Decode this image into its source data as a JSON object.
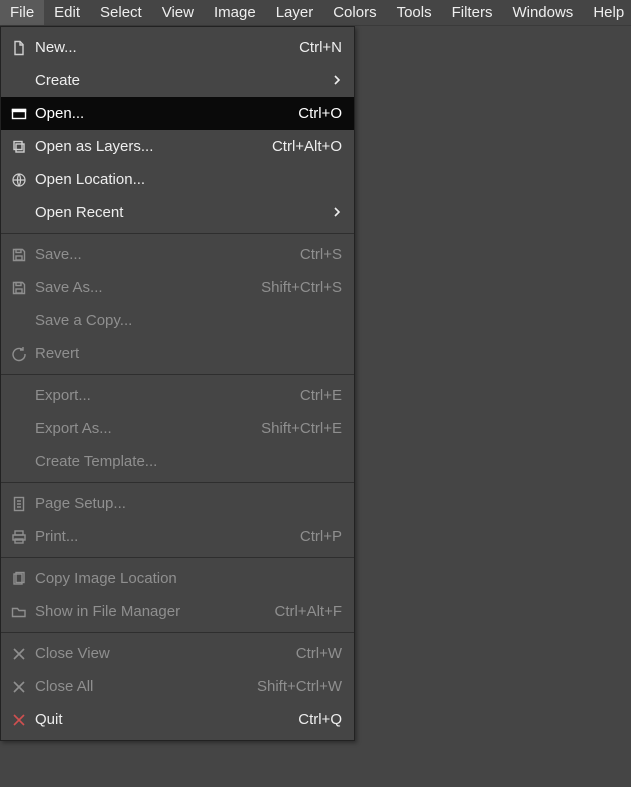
{
  "menubar": {
    "items": [
      "File",
      "Edit",
      "Select",
      "View",
      "Image",
      "Layer",
      "Colors",
      "Tools",
      "Filters",
      "Windows",
      "Help"
    ],
    "active_index": 0
  },
  "file_menu": {
    "highlighted_index": 2,
    "items": [
      {
        "icon": "new-icon",
        "label": "New...",
        "accel": "Ctrl+N",
        "enabled": true,
        "submenu": false
      },
      {
        "icon": "",
        "label": "Create",
        "accel": "",
        "enabled": true,
        "submenu": true
      },
      {
        "icon": "open-icon",
        "label": "Open...",
        "accel": "Ctrl+O",
        "enabled": true,
        "submenu": false
      },
      {
        "icon": "layers-icon",
        "label": "Open as Layers...",
        "accel": "Ctrl+Alt+O",
        "enabled": true,
        "submenu": false
      },
      {
        "icon": "globe-icon",
        "label": "Open Location...",
        "accel": "",
        "enabled": true,
        "submenu": false
      },
      {
        "icon": "",
        "label": "Open Recent",
        "accel": "",
        "enabled": true,
        "submenu": true
      },
      {
        "sep": true
      },
      {
        "icon": "save-icon",
        "label": "Save...",
        "accel": "Ctrl+S",
        "enabled": false,
        "submenu": false
      },
      {
        "icon": "saveas-icon",
        "label": "Save As...",
        "accel": "Shift+Ctrl+S",
        "enabled": false,
        "submenu": false
      },
      {
        "icon": "",
        "label": "Save a Copy...",
        "accel": "",
        "enabled": false,
        "submenu": false
      },
      {
        "icon": "revert-icon",
        "label": "Revert",
        "accel": "",
        "enabled": false,
        "submenu": false
      },
      {
        "sep": true
      },
      {
        "icon": "",
        "label": "Export...",
        "accel": "Ctrl+E",
        "enabled": false,
        "submenu": false
      },
      {
        "icon": "",
        "label": "Export As...",
        "accel": "Shift+Ctrl+E",
        "enabled": false,
        "submenu": false
      },
      {
        "icon": "",
        "label": "Create Template...",
        "accel": "",
        "enabled": false,
        "submenu": false
      },
      {
        "sep": true
      },
      {
        "icon": "pagesetup-icon",
        "label": "Page Setup...",
        "accel": "",
        "enabled": false,
        "submenu": false
      },
      {
        "icon": "print-icon",
        "label": "Print...",
        "accel": "Ctrl+P",
        "enabled": false,
        "submenu": false
      },
      {
        "sep": true
      },
      {
        "icon": "copyloc-icon",
        "label": "Copy Image Location",
        "accel": "",
        "enabled": false,
        "submenu": false
      },
      {
        "icon": "folder-icon",
        "label": "Show in File Manager",
        "accel": "Ctrl+Alt+F",
        "enabled": false,
        "submenu": false
      },
      {
        "sep": true
      },
      {
        "icon": "close-icon",
        "label": "Close View",
        "accel": "Ctrl+W",
        "enabled": false,
        "submenu": false
      },
      {
        "icon": "closeall-icon",
        "label": "Close All",
        "accel": "Shift+Ctrl+W",
        "enabled": false,
        "submenu": false
      },
      {
        "icon": "quit-icon",
        "label": "Quit",
        "accel": "Ctrl+Q",
        "enabled": true,
        "submenu": false
      }
    ]
  }
}
